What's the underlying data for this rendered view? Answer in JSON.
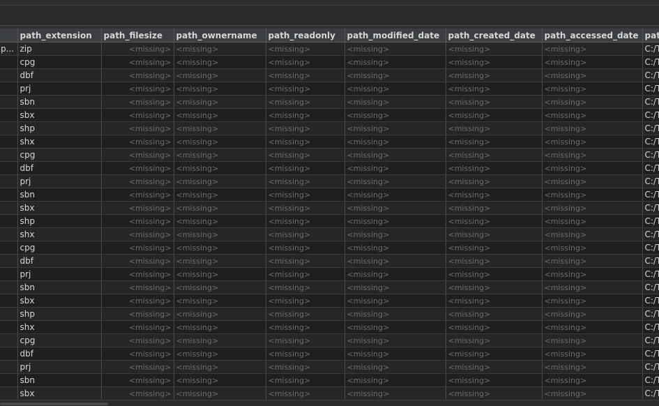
{
  "table": {
    "columns": [
      {
        "label": ""
      },
      {
        "label": "path_extension"
      },
      {
        "label": "path_filesize"
      },
      {
        "label": "path_ownername"
      },
      {
        "label": "path_readonly"
      },
      {
        "label": "path_modified_date"
      },
      {
        "label": "path_created_date"
      },
      {
        "label": "path_accessed_date"
      },
      {
        "label": "path"
      }
    ],
    "missing_text": "<missing>",
    "rows": [
      {
        "c0": "p...",
        "ext": "zip",
        "path": "C:/T"
      },
      {
        "c0": "",
        "ext": "cpg",
        "path": "C:/T"
      },
      {
        "c0": "",
        "ext": "dbf",
        "path": "C:/T"
      },
      {
        "c0": "",
        "ext": "prj",
        "path": "C:/T"
      },
      {
        "c0": "",
        "ext": "sbn",
        "path": "C:/T"
      },
      {
        "c0": "",
        "ext": "sbx",
        "path": "C:/T"
      },
      {
        "c0": "",
        "ext": "shp",
        "path": "C:/T"
      },
      {
        "c0": "",
        "ext": "shx",
        "path": "C:/T"
      },
      {
        "c0": "",
        "ext": "cpg",
        "path": "C:/T"
      },
      {
        "c0": "",
        "ext": "dbf",
        "path": "C:/T"
      },
      {
        "c0": "",
        "ext": "prj",
        "path": "C:/T"
      },
      {
        "c0": "",
        "ext": "sbn",
        "path": "C:/T"
      },
      {
        "c0": "",
        "ext": "sbx",
        "path": "C:/T"
      },
      {
        "c0": "",
        "ext": "shp",
        "path": "C:/T"
      },
      {
        "c0": "",
        "ext": "shx",
        "path": "C:/T"
      },
      {
        "c0": "",
        "ext": "cpg",
        "path": "C:/T"
      },
      {
        "c0": "",
        "ext": "dbf",
        "path": "C:/T"
      },
      {
        "c0": "",
        "ext": "prj",
        "path": "C:/T"
      },
      {
        "c0": "",
        "ext": "sbn",
        "path": "C:/T"
      },
      {
        "c0": "",
        "ext": "sbx",
        "path": "C:/T"
      },
      {
        "c0": "",
        "ext": "shp",
        "path": "C:/T"
      },
      {
        "c0": "",
        "ext": "shx",
        "path": "C:/T"
      },
      {
        "c0": "",
        "ext": "cpg",
        "path": "C:/T"
      },
      {
        "c0": "",
        "ext": "dbf",
        "path": "C:/T"
      },
      {
        "c0": "",
        "ext": "prj",
        "path": "C:/T"
      },
      {
        "c0": "",
        "ext": "sbn",
        "path": "C:/T"
      },
      {
        "c0": "",
        "ext": "sbx",
        "path": "C:/T"
      }
    ]
  },
  "colors": {
    "background": "#323232",
    "header_bg": "#3c3f41",
    "row_odd": "#262626",
    "row_even": "#1f1f1f",
    "missing_text": "#6c6c6c"
  }
}
